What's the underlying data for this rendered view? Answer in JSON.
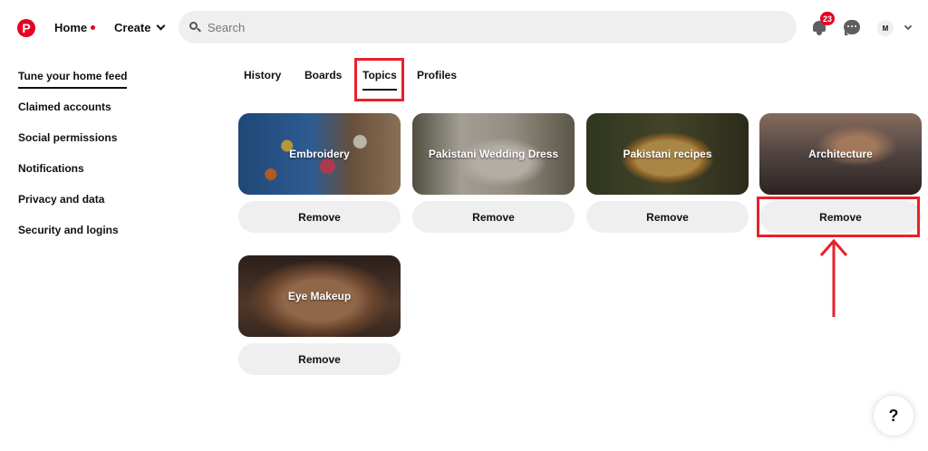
{
  "header": {
    "logo_glyph": "P",
    "home_label": "Home",
    "create_label": "Create",
    "search_placeholder": "Search",
    "notification_count": "23",
    "avatar_initial": "M"
  },
  "sidebar": {
    "items": [
      {
        "label": "Tune your home feed",
        "active": true
      },
      {
        "label": "Claimed accounts"
      },
      {
        "label": "Social permissions"
      },
      {
        "label": "Notifications"
      },
      {
        "label": "Privacy and data"
      },
      {
        "label": "Security and logins"
      }
    ]
  },
  "tabs": [
    {
      "label": "History"
    },
    {
      "label": "Boards"
    },
    {
      "label": "Topics",
      "active": true
    },
    {
      "label": "Profiles"
    }
  ],
  "topics": [
    {
      "name": "Embroidery",
      "action": "Remove"
    },
    {
      "name": "Pakistani Wedding Dress",
      "action": "Remove"
    },
    {
      "name": "Pakistani recipes",
      "action": "Remove"
    },
    {
      "name": "Architecture",
      "action": "Remove"
    },
    {
      "name": "Eye Makeup",
      "action": "Remove"
    }
  ],
  "help": {
    "label": "?"
  },
  "colors": {
    "brand": "#e60023",
    "annotation": "#e8212a",
    "button_bg": "#efefef"
  }
}
